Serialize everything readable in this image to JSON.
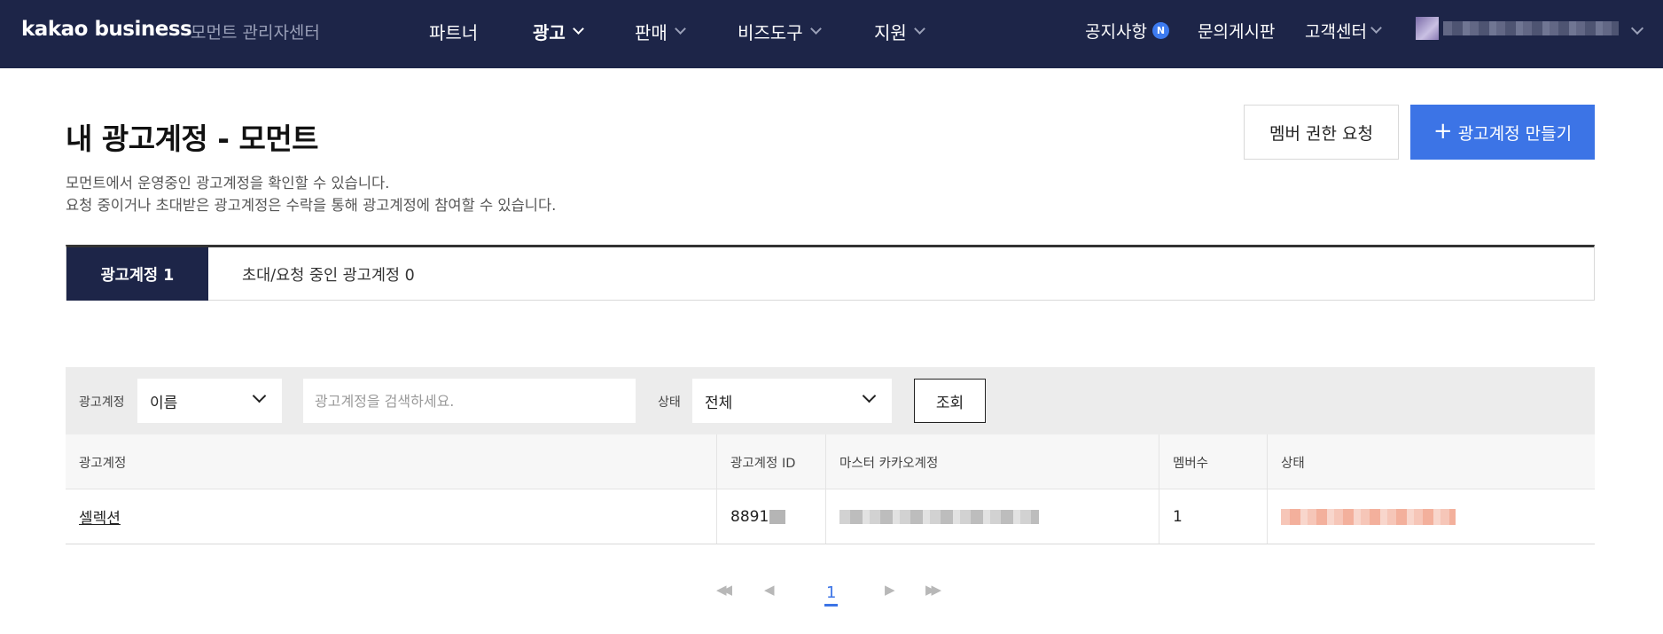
{
  "header": {
    "logo": "kakao business",
    "service_name": "모먼트 관리자센터",
    "nav": [
      {
        "label": "파트너",
        "has_menu": false
      },
      {
        "label": "광고",
        "has_menu": true,
        "active": true
      },
      {
        "label": "판매",
        "has_menu": true
      },
      {
        "label": "비즈도구",
        "has_menu": true
      },
      {
        "label": "지원",
        "has_menu": true
      }
    ],
    "notice": "공지사항",
    "notice_badge": "N",
    "inquiry": "문의게시판",
    "support": "고객센터"
  },
  "page": {
    "title": "내 광고계정 - 모먼트",
    "desc_line1": "모먼트에서 운영중인 광고계정을 확인할 수 있습니다.",
    "desc_line2": "요청 중이거나 초대받은 광고계정은 수락을 통해 광고계정에 참여할 수 있습니다.",
    "member_request_btn": "멤버 권한 요청",
    "create_btn": "광고계정 만들기",
    "create_btn_icon": "+"
  },
  "tabs": [
    {
      "label": "광고계정 1",
      "active": true
    },
    {
      "label": "초대/요청 중인 광고계정 0",
      "active": false
    }
  ],
  "filter": {
    "account_label": "광고계정",
    "account_select": "이름",
    "search_placeholder": "광고계정을 검색하세요.",
    "status_label": "상태",
    "status_select": "전체",
    "search_btn": "조회"
  },
  "table": {
    "columns": [
      "광고계정",
      "광고계정 ID",
      "마스터 카카오계정",
      "멤버수",
      "상태"
    ],
    "rows": [
      {
        "name": "셀렉션",
        "id": "8891",
        "members": "1"
      }
    ]
  },
  "pagination": {
    "current": "1",
    "first": "◀◀",
    "prev": "◀",
    "next": "▶",
    "last": "▶▶"
  },
  "colors": {
    "header_bg": "#1d2548",
    "primary": "#3c74e6"
  }
}
